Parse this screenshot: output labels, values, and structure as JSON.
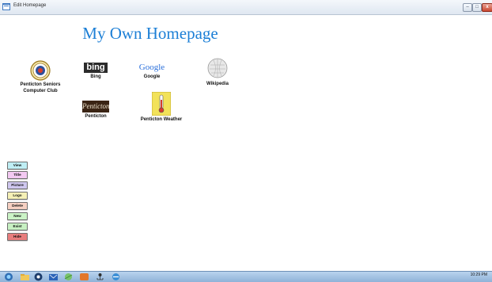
{
  "window": {
    "title": "Edit Homepage"
  },
  "page": {
    "heading": "My Own Homepage"
  },
  "links": [
    {
      "label": "Penticton Seniors Computer Club"
    },
    {
      "label": "Bing",
      "logo_text": "bing"
    },
    {
      "label": "Google",
      "logo_text": "Google"
    },
    {
      "label": "Wikipedia"
    },
    {
      "label": "Penticton",
      "logo_text": "Penticton"
    },
    {
      "label": "Penticton Weather"
    }
  ],
  "buttons": [
    {
      "label": "View",
      "color": "#bfeef4"
    },
    {
      "label": "Title",
      "color": "#f3c9f2"
    },
    {
      "label": "Picture",
      "color": "#cfc7ef"
    },
    {
      "label": "Logo",
      "color": "#f5f0b6"
    },
    {
      "label": "Delete",
      "color": "#f6d0c2"
    },
    {
      "label": "New",
      "color": "#cbf3c6"
    },
    {
      "label": "Exist",
      "color": "#c7f0c2"
    },
    {
      "label": "Hide",
      "color": "#e87d7d"
    }
  ],
  "taskbar": {
    "items": [
      "start-orb-icon",
      "folder-icon",
      "media-player-icon",
      "outlook-icon",
      "browser-icon",
      "app-icon",
      "network-icon",
      "ie-icon"
    ],
    "clock": "10:29 PM"
  },
  "colors": {
    "heading": "#1c7fd6",
    "accent": "#1c7fd6"
  }
}
